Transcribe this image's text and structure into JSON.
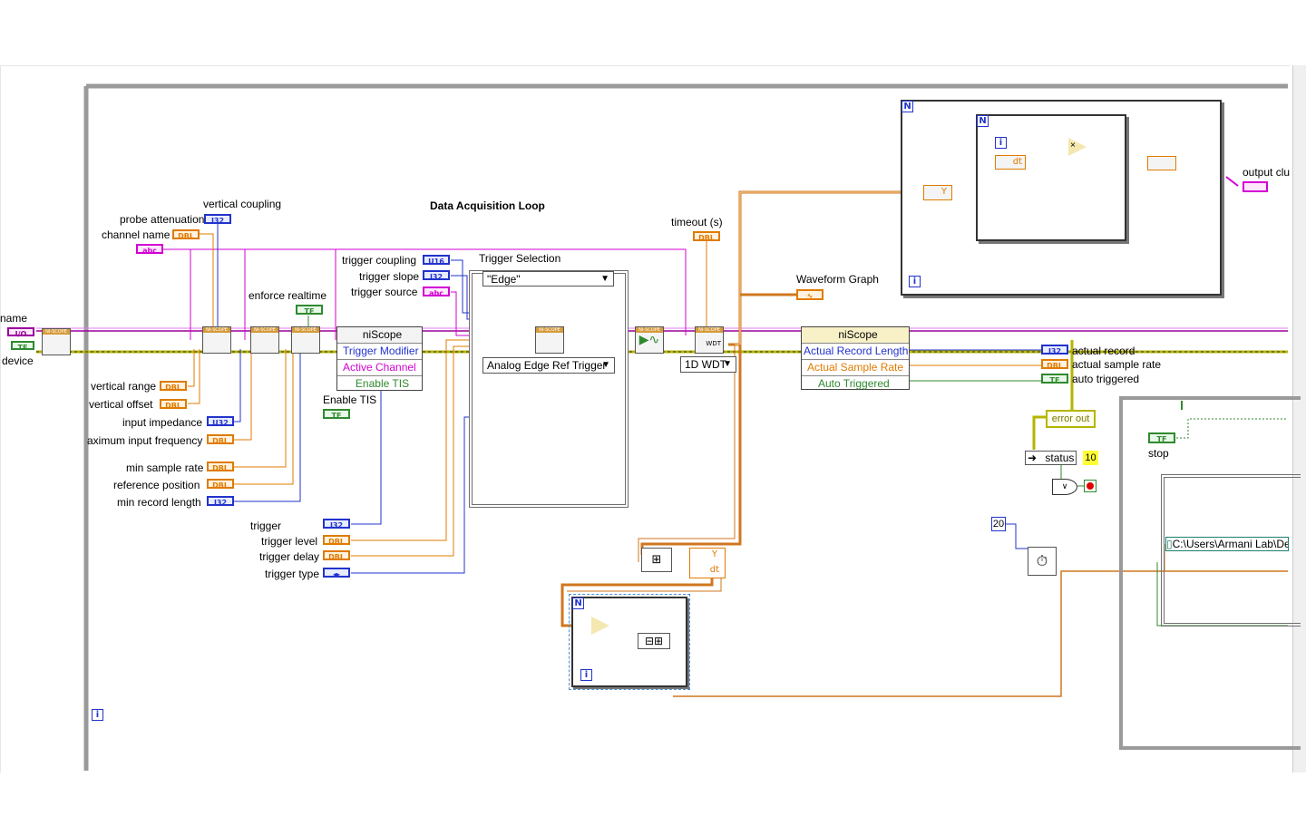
{
  "diagram": {
    "loop_title": "Data Acquisition Loop",
    "left_labels": {
      "name": "name",
      "device": "device",
      "vertical_coupling": "vertical coupling",
      "probe_attenuation": "probe attenuation",
      "channel_name": "channel name",
      "enforce_realtime": "enforce realtime",
      "vertical_range": "vertical range",
      "vertical_offset": "vertical offset",
      "input_impedance": "input impedance",
      "max_input_frequency": "aximum input frequency",
      "min_sample_rate": "min sample rate",
      "reference_position": "reference position",
      "min_record_length": "min record length",
      "enable_tis": "Enable TIS",
      "trigger": "trigger",
      "trigger_level": "trigger level",
      "trigger_delay": "trigger delay",
      "trigger_type": "trigger type",
      "trigger_coupling": "trigger coupling",
      "trigger_slope": "trigger slope",
      "trigger_source": "trigger source",
      "trigger_selection": "Trigger Selection",
      "timeout": "timeout (s)",
      "waveform_graph": "Waveform Graph",
      "output_cluster": "output clu"
    },
    "terminal_types": {
      "dbl": "DBL",
      "i32": "I32",
      "u32": "U32",
      "u16": "U16",
      "abc": "abc",
      "tf": "TF",
      "io": "I/O",
      "enum": "◂▸"
    },
    "property_node_1": {
      "header": "niScope",
      "rows": [
        "Trigger Modifier",
        "Active Channel",
        "Enable TIS"
      ]
    },
    "property_node_2": {
      "header": "niScope",
      "rows": [
        "Actual Record Length",
        "Actual Sample Rate",
        "Auto Triggered"
      ]
    },
    "case_selector": "\"Edge\"",
    "trigger_vi_ring": "Analog Edge Ref Trigger",
    "fetch_ring": "1D WDT",
    "right_labels": {
      "actual_record": "actual record",
      "actual_sample_rate": "actual sample rate",
      "auto_triggered": "auto triggered",
      "error_out": "error out",
      "status": "status",
      "stop": "stop"
    },
    "constants": {
      "ten": "10",
      "twenty": "20",
      "path": "C:\\Users\\Armani Lab\\De"
    },
    "inline_labels": {
      "dt": "dt",
      "y": "Y",
      "i": "i",
      "n": "N",
      "wdt": "WDT"
    },
    "colors": {
      "error_wire": "#c9c900",
      "session_wire": "#9b009b",
      "dbl": "#e07b00",
      "int": "#2233cc",
      "string": "#d300d3",
      "bool": "#2f8a2f",
      "frame": "#9a9a9a"
    }
  }
}
